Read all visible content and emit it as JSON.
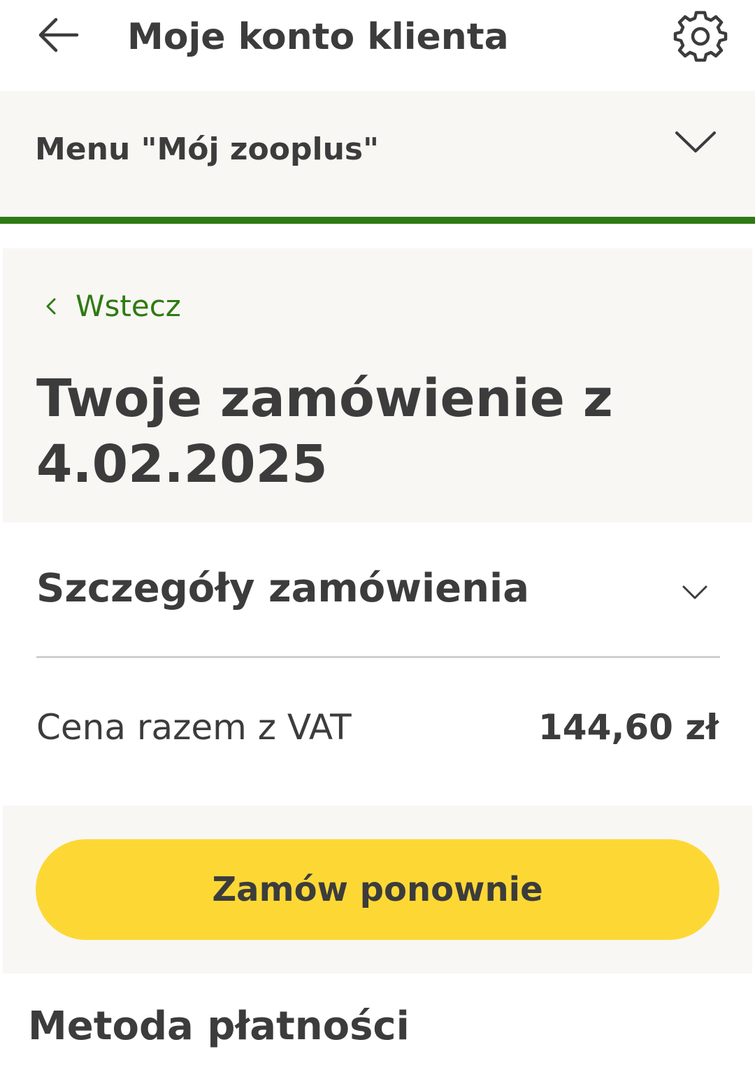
{
  "header": {
    "title": "Moje konto klienta",
    "back_icon": "arrow-left-icon",
    "settings_icon": "gear-icon"
  },
  "menu": {
    "label": "Menu \"Mój zooplus\"",
    "chevron_icon": "chevron-down-icon"
  },
  "order": {
    "back_label": "Wstecz",
    "title_line1": "Twoje zamówienie z",
    "title_line2": "4.02.2025",
    "details_title": "Szczegóły zamówienia",
    "price_label": "Cena razem z VAT",
    "price_value": "144,60 zł",
    "reorder_label": "Zamów ponownie"
  },
  "payment": {
    "title": "Metoda płatności"
  },
  "colors": {
    "accent_green": "#2f7a12",
    "button_yellow": "#fdd835",
    "panel_bg": "#f8f7f4",
    "text": "#3c3c3c"
  }
}
